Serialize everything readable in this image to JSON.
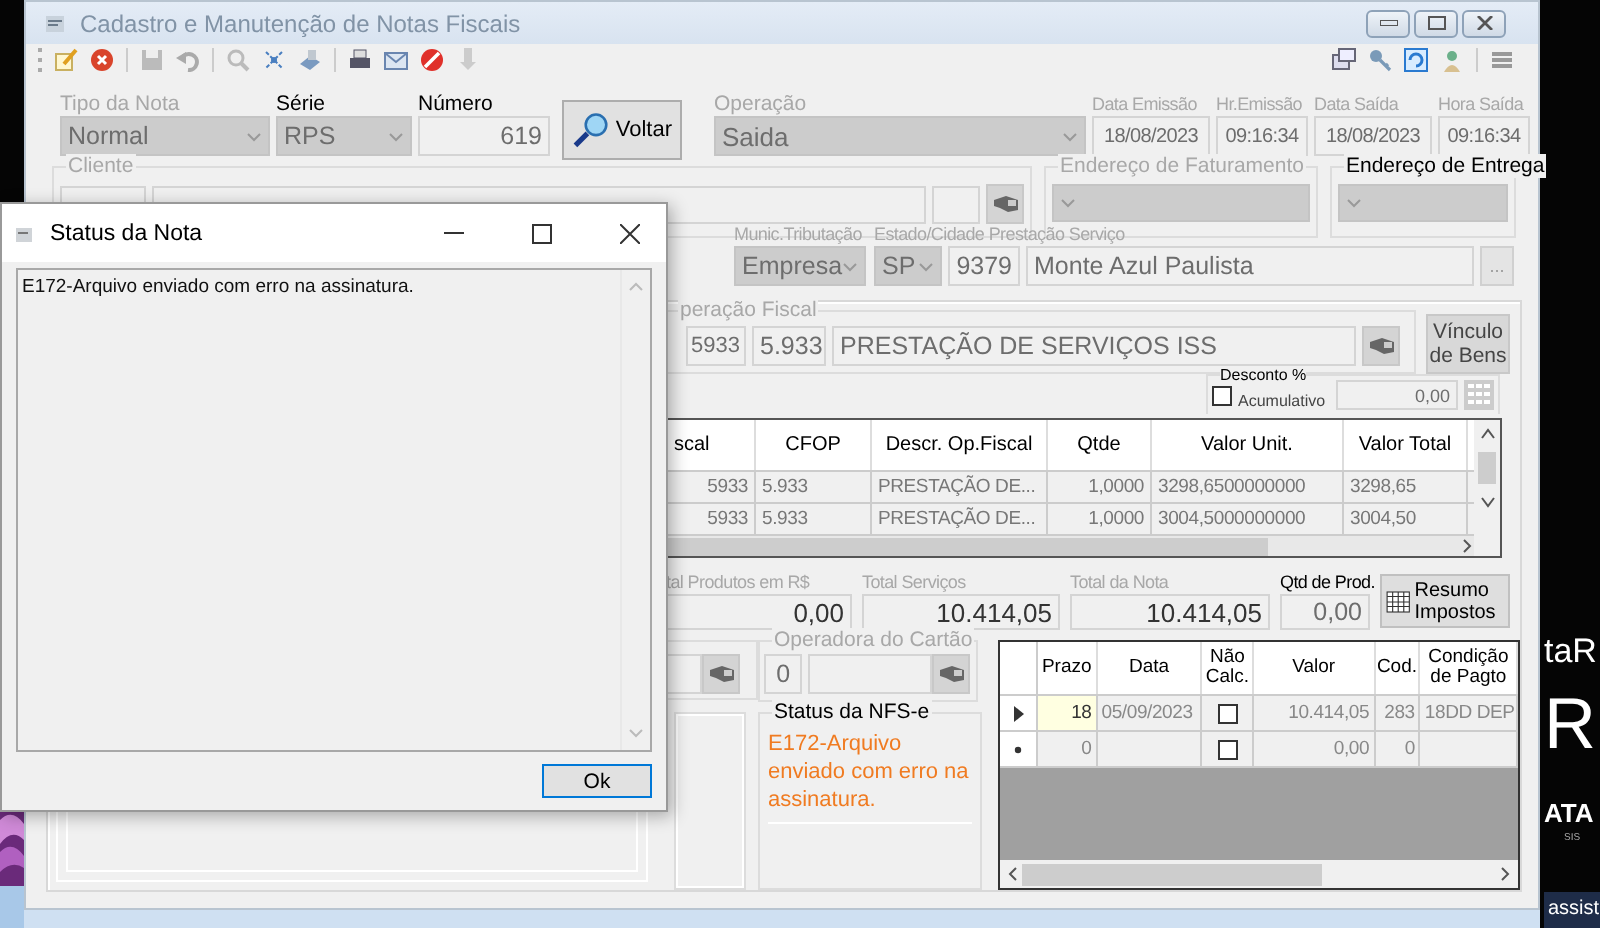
{
  "window": {
    "title": "Cadastro e Manutenção de Notas Fiscais"
  },
  "header": {
    "fields": [
      {
        "label": "Tipo da Nota",
        "value": "Normal",
        "kind": "combo",
        "disabled": true
      },
      {
        "label": "Série",
        "value": "RPS",
        "kind": "combo",
        "disabled": false
      },
      {
        "label": "Número",
        "value": "619",
        "kind": "number",
        "disabled": false
      }
    ],
    "voltar_button": "Voltar",
    "operacao": {
      "label": "Operação",
      "value": "Saida"
    },
    "dates": [
      {
        "label": "Data Emissão",
        "value": "18/08/2023"
      },
      {
        "label": "Hr.Emissão",
        "value": "09:16:34"
      },
      {
        "label": "Data Saída",
        "value": "18/08/2023"
      },
      {
        "label": "Hora Saída",
        "value": "09:16:34"
      }
    ]
  },
  "cliente": {
    "label": "Cliente"
  },
  "enderecos": [
    {
      "label": "Endereço de Faturamento",
      "disabled": true
    },
    {
      "label": "Endereço de Entrega",
      "disabled": false
    }
  ],
  "location": {
    "munic_label": "Munic.Tributação",
    "munic_value": "Empresa",
    "estado_label": "Estado/Cidade Prestação Serviço",
    "uf": "SP",
    "city_code": "9379",
    "city": "Monte Azul Paulista",
    "more_button": "..."
  },
  "operacao_fiscal": {
    "label": "peração Fiscal",
    "code": "5933",
    "cfop": "5.933",
    "description": "PRESTAÇÃO DE SERVIÇOS ISS"
  },
  "vinculo_button": "Vínculo de Bens",
  "desconto": {
    "label": "Desconto %",
    "checkbox_label": "Acumulativo",
    "checked": false,
    "value": "0,00"
  },
  "items_table": {
    "columns": [
      "scal",
      "CFOP",
      "Descr. Op.Fiscal",
      "Qtde",
      "Valor Unit.",
      "Valor Total"
    ],
    "rows": [
      [
        "5933",
        "5.933",
        "PRESTAÇÃO DE...",
        "1,0000",
        "3298,6500000000",
        "3298,65"
      ],
      [
        "5933",
        "5.933",
        "PRESTAÇÃO DE...",
        "1,0000",
        "3004,5000000000",
        "3004,50"
      ]
    ]
  },
  "totals": [
    {
      "label": "tal Produtos em R$",
      "value": "0,00",
      "disabled": true
    },
    {
      "label": "Total Serviços",
      "value": "10.414,05",
      "disabled": true
    },
    {
      "label": "Total da Nota",
      "value": "10.414,05",
      "disabled": true
    },
    {
      "label": "Qtd de Prod.",
      "value": "0,00",
      "disabled": false
    }
  ],
  "resumo_button": "Resumo Impostos",
  "cartao": {
    "operadora_label": "Operadora do Cartão",
    "code": "0"
  },
  "nfse_status": {
    "label": "Status da NFS-e",
    "message": "E172-Arquivo enviado com erro na assinatura."
  },
  "payments": {
    "columns": [
      "Prazo",
      "Data",
      "Não Calc.",
      "Valor",
      "Cod.",
      "Condição de Pagto"
    ],
    "rows": [
      {
        "kind": "current",
        "prazo": "18",
        "data": "05/09/2023",
        "nao_calc": false,
        "valor": "10.414,05",
        "cod": "283",
        "condicao": "18DD DEP"
      },
      {
        "kind": "new",
        "prazo": "0",
        "nao_calc": false,
        "valor": "0,00",
        "cod": "0"
      }
    ]
  },
  "dialog": {
    "title": "Status da Nota",
    "message": "E172-Arquivo enviado com erro na assinatura.",
    "ok_button": "Ok"
  },
  "wallpaper_texts": [
    "taR",
    "R",
    "ATA",
    "SIS",
    "assist"
  ]
}
